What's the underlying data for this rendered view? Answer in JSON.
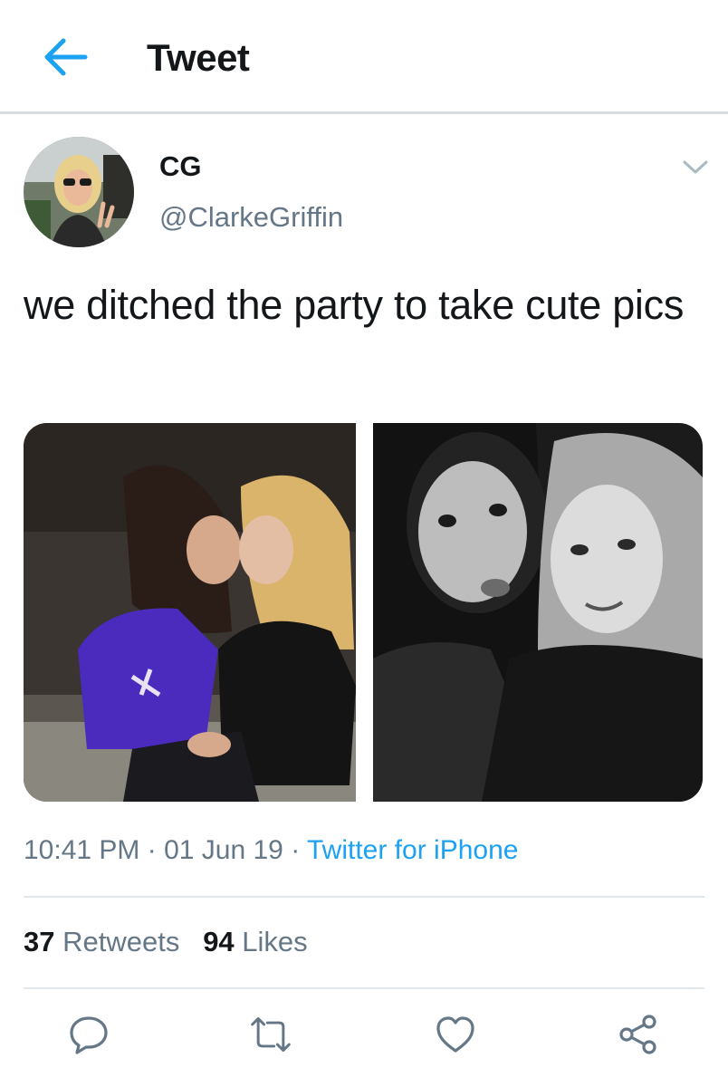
{
  "header": {
    "title": "Tweet",
    "back_icon": "back-arrow-icon"
  },
  "author": {
    "name": "CG",
    "handle": "@ClarkeGriffin",
    "avatar_icon": "avatar-photo"
  },
  "tweet": {
    "text": "we ditched the party to take cute pics",
    "time": "10:41 PM",
    "date": "01 Jun 19",
    "source": "Twitter for iPhone",
    "separator": " · "
  },
  "media": [
    {
      "name": "photo-1",
      "kind": "color photo of two people"
    },
    {
      "name": "photo-2",
      "kind": "black and white selfie of two people"
    }
  ],
  "stats": {
    "retweets_count": "37",
    "retweets_label": "Retweets",
    "likes_count": "94",
    "likes_label": "Likes"
  },
  "actions": [
    "reply-icon",
    "retweet-icon",
    "like-icon",
    "share-icon"
  ],
  "colors": {
    "accent": "#1da1f2",
    "muted": "#657786",
    "text": "#14171a",
    "divider": "#e1e8ed"
  }
}
